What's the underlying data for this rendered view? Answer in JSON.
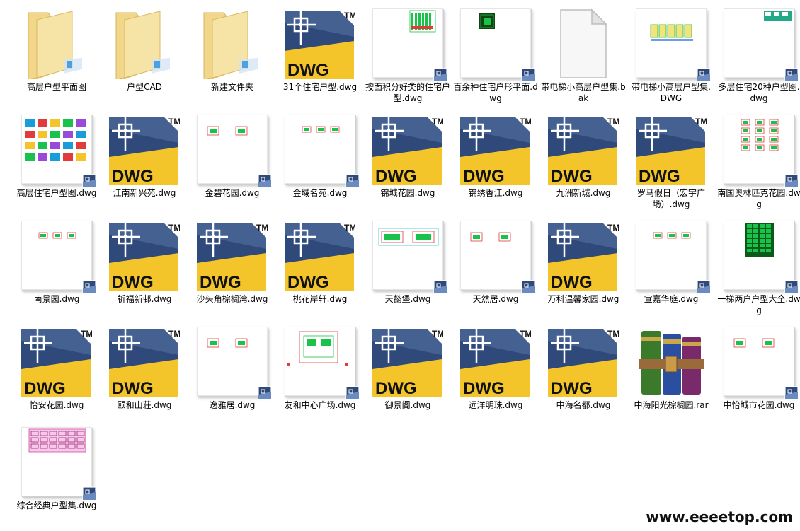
{
  "watermark": "www.eeeetop.com",
  "icon_glyphs": {
    "dwg_text": "DWG",
    "tm_text": "TM"
  },
  "colors": {
    "dwg_blue": "#2f4a7a",
    "dwg_yellow": "#f3c52a",
    "folder": "#f2d68a",
    "plan_green": "#19c24a",
    "plan_red": "#e23b3b",
    "plan_cyan": "#26c6d4"
  },
  "files": [
    {
      "name": "高层户型平面图",
      "type": "folder"
    },
    {
      "name": "户型CAD",
      "type": "folder"
    },
    {
      "name": "新建文件夹",
      "type": "folder"
    },
    {
      "name": "31个住宅户型.dwg",
      "type": "dwg"
    },
    {
      "name": "按面积分好类的住宅户型.dwg",
      "type": "preview",
      "preview": "tallplan"
    },
    {
      "name": "百余种住宅户形平面.dwg",
      "type": "preview",
      "preview": "smallsquare"
    },
    {
      "name": "带电梯小高层户型集.bak",
      "type": "blank"
    },
    {
      "name": "带电梯小高层户型集.DWG",
      "type": "preview",
      "preview": "yellowrow"
    },
    {
      "name": "多层住宅20种户型图.dwg",
      "type": "preview",
      "preview": "cornergrid"
    },
    {
      "name": "高层住宅户型图.dwg",
      "type": "preview",
      "preview": "colorgrid"
    },
    {
      "name": "江南新兴苑.dwg",
      "type": "dwg"
    },
    {
      "name": "金碧花园.dwg",
      "type": "preview",
      "preview": "twoplans"
    },
    {
      "name": "金域名苑.dwg",
      "type": "preview",
      "preview": "threeplans"
    },
    {
      "name": "锦城花园.dwg",
      "type": "dwg"
    },
    {
      "name": "锦绣香江.dwg",
      "type": "dwg"
    },
    {
      "name": "九洲新城.dwg",
      "type": "dwg"
    },
    {
      "name": "罗马假日（宏宇广场）.dwg",
      "type": "dwg"
    },
    {
      "name": "南国奥林匹克花园.dwg",
      "type": "preview",
      "preview": "columnplans"
    },
    {
      "name": "南景园.dwg",
      "type": "preview",
      "preview": "threeplans"
    },
    {
      "name": "祈福新邨.dwg",
      "type": "dwg"
    },
    {
      "name": "沙头角棕榈湾.dwg",
      "type": "dwg"
    },
    {
      "name": "桃花岸轩.dwg",
      "type": "dwg"
    },
    {
      "name": "天懿堡.dwg",
      "type": "preview",
      "preview": "widesheet"
    },
    {
      "name": "天然居.dwg",
      "type": "preview",
      "preview": "twoplans"
    },
    {
      "name": "万科温馨家园.dwg",
      "type": "dwg"
    },
    {
      "name": "宣嘉华庭.dwg",
      "type": "preview",
      "preview": "threeplans"
    },
    {
      "name": "一梯两户户型大全.dwg",
      "type": "preview",
      "preview": "tallgreen"
    },
    {
      "name": "怡安花园.dwg",
      "type": "dwg"
    },
    {
      "name": "颐和山荘.dwg",
      "type": "dwg"
    },
    {
      "name": "逸雅居.dwg",
      "type": "preview",
      "preview": "twoplans"
    },
    {
      "name": "友和中心广场.dwg",
      "type": "preview",
      "preview": "bigplan"
    },
    {
      "name": "御景阁.dwg",
      "type": "dwg"
    },
    {
      "name": "远洋明珠.dwg",
      "type": "dwg"
    },
    {
      "name": "中海名都.dwg",
      "type": "dwg"
    },
    {
      "name": "中海阳光棕榈园.rar",
      "type": "rar"
    },
    {
      "name": "中怡城市花园.dwg",
      "type": "preview",
      "preview": "twoplans"
    },
    {
      "name": "综合经典户型集.dwg",
      "type": "preview",
      "preview": "pinkgrid"
    }
  ]
}
